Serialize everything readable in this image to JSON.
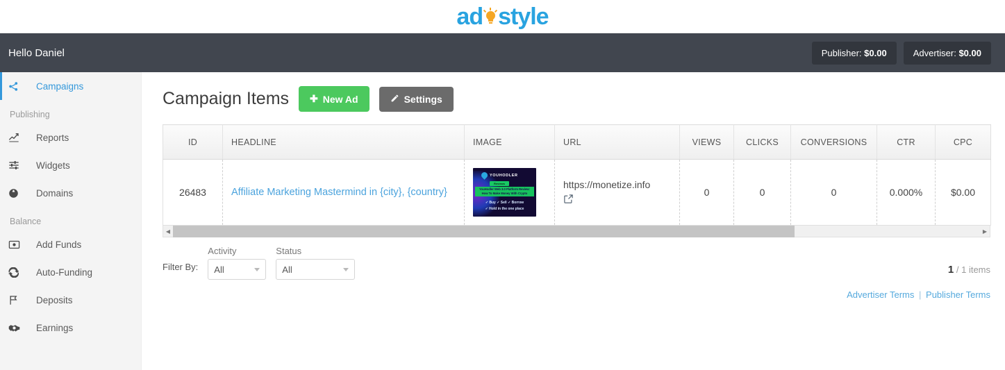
{
  "brand": {
    "name_part1": "ad",
    "name_part2": "style",
    "logo_icon": "lightbulb-icon",
    "blue": "#29a3e0",
    "orange": "#f5a623"
  },
  "topbar": {
    "greeting": "Hello Daniel",
    "publisher_label": "Publisher:",
    "publisher_amount": "$0.00",
    "advertiser_label": "Advertiser:",
    "advertiser_amount": "$0.00"
  },
  "sidebar": {
    "primary": {
      "label": "Campaigns",
      "icon": "share-icon"
    },
    "sections": [
      {
        "title": "Publishing",
        "items": [
          {
            "label": "Reports",
            "icon": "chart-line-icon"
          },
          {
            "label": "Widgets",
            "icon": "sliders-icon"
          },
          {
            "label": "Domains",
            "icon": "globe-icon"
          }
        ]
      },
      {
        "title": "Balance",
        "items": [
          {
            "label": "Add Funds",
            "icon": "money-bill-icon"
          },
          {
            "label": "Auto-Funding",
            "icon": "sync-icon"
          },
          {
            "label": "Deposits",
            "icon": "flag-icon"
          },
          {
            "label": "Earnings",
            "icon": "handshake-icon"
          }
        ]
      }
    ]
  },
  "main": {
    "page_title": "Campaign Items",
    "new_ad_button": "New Ad",
    "settings_button": "Settings",
    "table": {
      "columns": [
        "ID",
        "HEADLINE",
        "IMAGE",
        "URL",
        "VIEWS",
        "CLICKS",
        "CONVERSIONS",
        "CTR",
        "CPC"
      ],
      "rows": [
        {
          "id": "26483",
          "headline": "Affiliate Marketing Mastermind in {city}, {country}",
          "image_alt": "youhodler-ad-banner",
          "image": {
            "brand": "YOUHODLER",
            "tab": "Reviews",
            "headline_line1": "YouHodler Web 3.0 Platform Review:",
            "headline_line2": "How To Make Money With Crypto",
            "bullets_line1": "✓ Buy  ✓ Sell  ✓ Borrow",
            "bullets_line2": "✓ Hold in the one place"
          },
          "url": "https://monetize.info",
          "views": "0",
          "clicks": "0",
          "conversions": "0",
          "ctr": "0.000%",
          "cpc": "$0.00"
        }
      ]
    },
    "filters": {
      "label": "Filter By:",
      "activity": {
        "caption": "Activity",
        "value": "All"
      },
      "status": {
        "caption": "Status",
        "value": "All"
      }
    },
    "pagination": {
      "current": "1",
      "suffix": "/ 1 items"
    },
    "footer": {
      "advertiser_terms": "Advertiser Terms",
      "separator": "|",
      "publisher_terms": "Publisher Terms"
    }
  }
}
